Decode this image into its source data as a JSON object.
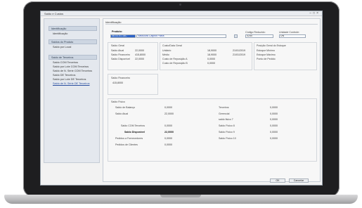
{
  "window": {
    "title": "Saldo e Custos"
  },
  "sidebar": {
    "sections": [
      {
        "header": "Identificação",
        "items": [
          "Identificação"
        ]
      },
      {
        "header": "Saldos do Produto",
        "items": [
          "Saldo por Local"
        ]
      },
      {
        "header": "Saldo de Terceiros",
        "items": [
          "Saldo COM Terceiros",
          "Saldo por Lote COM Terceiros",
          "Saldo de N. Série COM Terceiros",
          "Saldo DE Terceiros",
          "Saldo por Lote DE Terceiros",
          "Saldo de N. Série DE Terceiros"
        ]
      }
    ]
  },
  "main": {
    "title": "Identificação",
    "product": {
      "label": "Produto:",
      "code": "06.03.01.18C",
      "description": "Vassoura Caipira Palha",
      "reduced_code_label": "Código Reduzido:",
      "reduced_code": "0250",
      "unit_label": "Unidade Controle:",
      "unit": "UN"
    },
    "saldo_geral": {
      "title": "Saldo Geral",
      "rows": [
        {
          "label": "Saldo Atual",
          "value": "22,0000"
        },
        {
          "label": "Saldo Financeiro",
          "value": "415,8000"
        },
        {
          "label": "Saldo Disponível",
          "value": "22,0000"
        }
      ]
    },
    "custo_geral": {
      "title": "Custo/Data Geral",
      "rows": [
        {
          "label": "Unitário",
          "value": "18,9000",
          "date": "21/01/2019"
        },
        {
          "label": "Médio",
          "value": "18,9000",
          "date": "21/01/2019"
        },
        {
          "label": "Custo de Reposição A",
          "value": "0,0000",
          "date": ""
        },
        {
          "label": "Custo de Reposição B",
          "value": "0,0000",
          "date": ""
        }
      ]
    },
    "estoque": {
      "title": "Posição Geral do Estoque",
      "rows": [
        "Estoque Mínimo",
        "Estoque Máximo",
        "Ponto de Pedido"
      ]
    },
    "saldo_financeiro": {
      "title": "Saldo Financeiro",
      "value": "415,8000"
    },
    "saldo_fisico": {
      "title": "Saldo Físico",
      "left": [
        {
          "label": "Saldo de Balanço",
          "value": "0,0000",
          "bold": false
        },
        {
          "label": "Saldo Atual",
          "value": "22,0000",
          "bold": false
        },
        {
          "label": "Saldo COM Terceiros",
          "value": "0,0000",
          "bold": false
        },
        {
          "label": "Saldo Disponível",
          "value": "22,0000",
          "bold": true
        },
        {
          "label": "Pedidos a Fornecedores",
          "value": "0,0000",
          "bold": false
        },
        {
          "label": "Pedidos de Clientes",
          "value": "0,0000",
          "bold": false
        }
      ],
      "right": [
        {
          "label": "Terceiros",
          "value": "0,0000"
        },
        {
          "label": "Gerencial",
          "value": "0,0000"
        },
        {
          "label": "saldo fisico 7",
          "value": "0,0000"
        },
        {
          "label": "Saldo Físico 8",
          "value": "0,0000"
        },
        {
          "label": "Saldo Físico 9",
          "value": "0,0000"
        },
        {
          "label": "Saldo Físico 10",
          "value": "0,0000"
        }
      ]
    }
  },
  "footer": {
    "ok_label": "OK",
    "cancel_label": "Cancelar"
  }
}
